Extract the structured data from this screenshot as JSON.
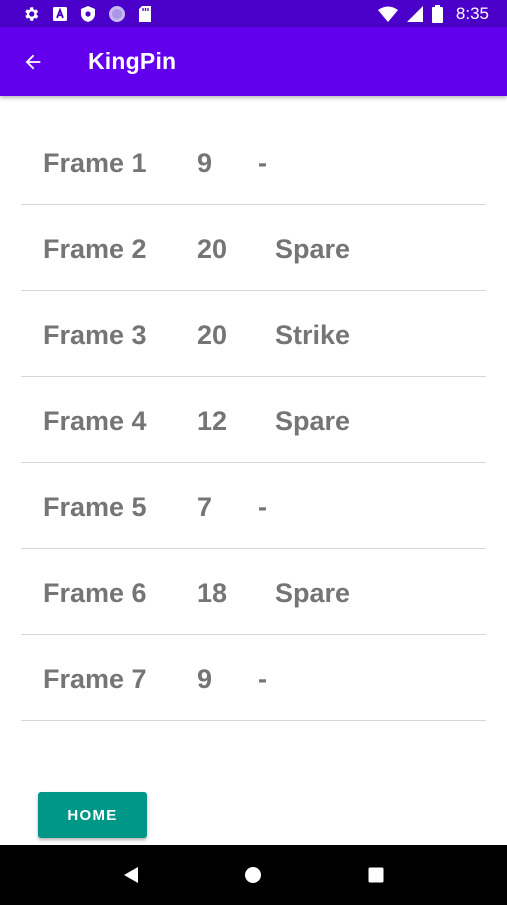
{
  "status_bar": {
    "time": "8:35",
    "left_icons": [
      "settings-icon",
      "a-badge-icon",
      "shield-icon",
      "circle-icon",
      "sd-card-icon"
    ],
    "right_icons": [
      "wifi-icon",
      "signal-icon",
      "battery-icon"
    ]
  },
  "app_bar": {
    "title": "KingPin",
    "back_icon": "arrow-left-icon",
    "color": "#6200ee"
  },
  "frames": [
    {
      "name": "Frame 1",
      "score": "9",
      "result": "-"
    },
    {
      "name": "Frame 2",
      "score": "20",
      "result": "Spare"
    },
    {
      "name": "Frame 3",
      "score": "20",
      "result": "Strike"
    },
    {
      "name": "Frame 4",
      "score": "12",
      "result": "Spare"
    },
    {
      "name": "Frame 5",
      "score": "7",
      "result": "-"
    },
    {
      "name": "Frame 6",
      "score": "18",
      "result": "Spare"
    },
    {
      "name": "Frame 7",
      "score": "9",
      "result": "-"
    }
  ],
  "home_button": {
    "label": "HOME",
    "color": "#009688"
  },
  "nav_bar": {
    "buttons": [
      "back-triangle-icon",
      "home-circle-icon",
      "recents-square-icon"
    ]
  }
}
